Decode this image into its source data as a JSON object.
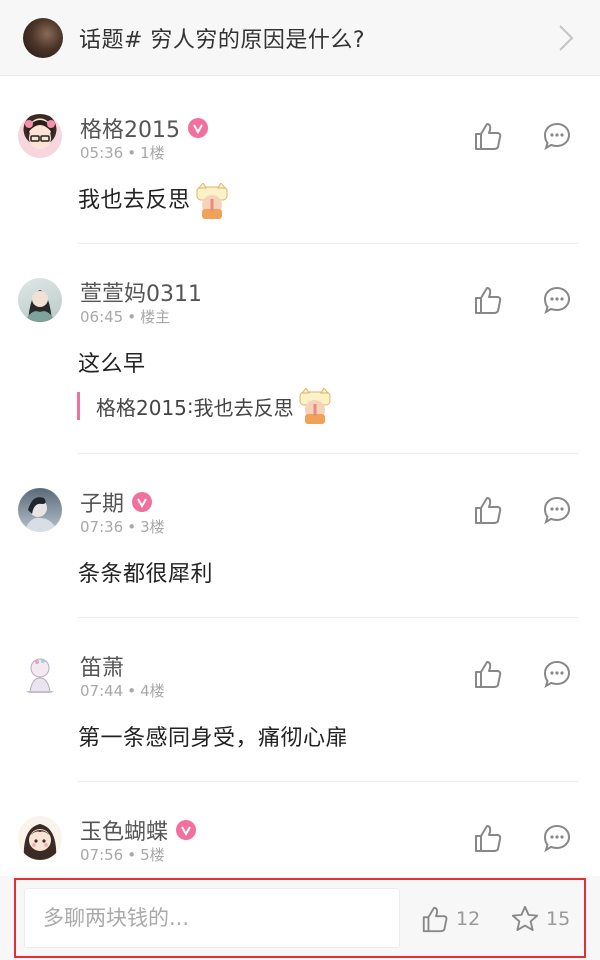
{
  "topic": {
    "title": "话题# 穷人穷的原因是什么?"
  },
  "comments": [
    {
      "name": "格格2015",
      "verified": true,
      "time": "05:36",
      "floor": "1楼",
      "text": "我也去反思",
      "text_emoji": "shh-cat-emoji"
    },
    {
      "name": "萱萱妈0311",
      "verified": false,
      "time": "06:45",
      "floor": "楼主",
      "text": "这么早",
      "quote": {
        "author": "格格2015",
        "sep": ": ",
        "text": "我也去反思",
        "emoji": "shh-cat-emoji"
      }
    },
    {
      "name": "子期",
      "verified": true,
      "time": "07:36",
      "floor": "3楼",
      "text": "条条都很犀利"
    },
    {
      "name": "笛萧",
      "verified": false,
      "time": "07:44",
      "floor": "4楼",
      "text": "第一条感同身受，痛彻心扉"
    },
    {
      "name": "玉色蝴蝶",
      "verified": true,
      "time": "07:56",
      "floor": "5楼",
      "text": ""
    }
  ],
  "meta_dot": "•",
  "bottom": {
    "placeholder": "多聊两块钱的...",
    "like_count": "12",
    "star_count": "15"
  },
  "colors": {
    "accent_pink": "#f2709c",
    "highlight_red": "#e0303a",
    "header_bg": "#f7f7f7"
  }
}
